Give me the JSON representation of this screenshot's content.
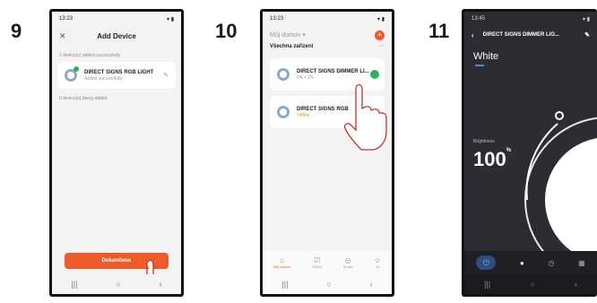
{
  "steps": [
    "9",
    "10",
    "11"
  ],
  "phone9": {
    "status_time": "13:23",
    "close_icon": "✕",
    "title": "Add Device",
    "added_line": "1 device(s) added successfully",
    "device_name": "DIRECT SIGNS RGB LIGHT",
    "device_status": "Added successfully",
    "being_added": "0 device(s) being added",
    "done_button": "Dokončeno"
  },
  "phone10": {
    "status_time": "13:23",
    "home_selector": "Můj domov",
    "section_title": "Všechna zařízení",
    "devices": [
      {
        "name": "DIRECT SIGNS DIMMER LI...",
        "sub": "0% • 1%",
        "online": true
      },
      {
        "name": "DIRECT SIGNS RGB",
        "sub": "Offline",
        "online": false
      }
    ],
    "tabs": [
      "Můj domov",
      "Scény",
      "Smart",
      "Já"
    ]
  },
  "phone11": {
    "status_time": "13:45",
    "title": "DIRECT SIGNS DIMMER LIG...",
    "mode": "White",
    "brightness_label": "Brightness",
    "brightness_value": "100",
    "brightness_unit": "%"
  }
}
